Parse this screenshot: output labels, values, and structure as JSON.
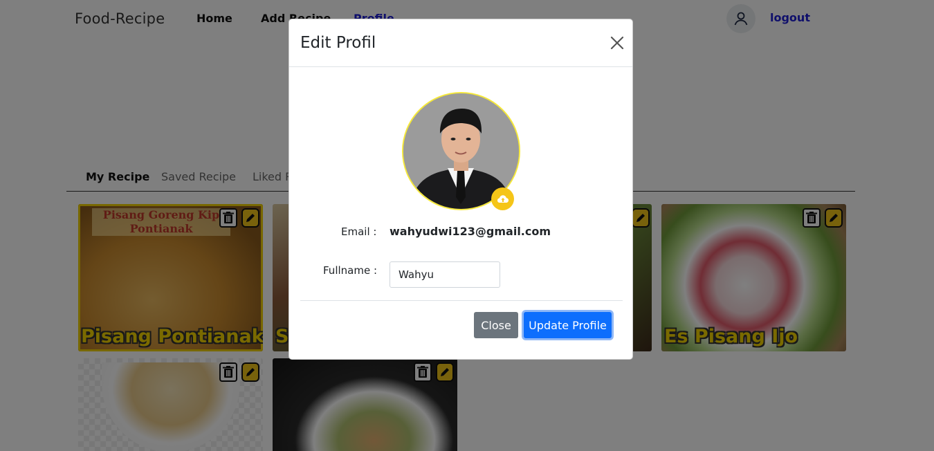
{
  "navbar": {
    "brand": "Food-Recipe",
    "links": [
      "Home",
      "Add Recipe",
      "Profile"
    ],
    "logout": "logout"
  },
  "tabs": [
    "My Recipe",
    "Saved Recipe",
    "Liked R"
  ],
  "cards": [
    {
      "title": "Pisang Pontianak",
      "image_caption": "Pisang Goreng Kip Pontianak"
    },
    {
      "title": "S"
    },
    {
      "title": "Es Pisang Ijo"
    },
    {
      "title": ""
    },
    {
      "title": ""
    }
  ],
  "modal": {
    "title": "Edit Profil",
    "email_label": "Email :",
    "email_value": "wahyudwi123@gmail.com",
    "fullname_label": "Fullname :",
    "fullname_value": "Wahyu",
    "close_label": "Close",
    "update_label": "Update Profile"
  },
  "colors": {
    "accent_yellow": "#f5c518",
    "primary_blue": "#0d6efd",
    "link_blue": "#1e1ed6",
    "secondary_gray": "#6c757d"
  }
}
